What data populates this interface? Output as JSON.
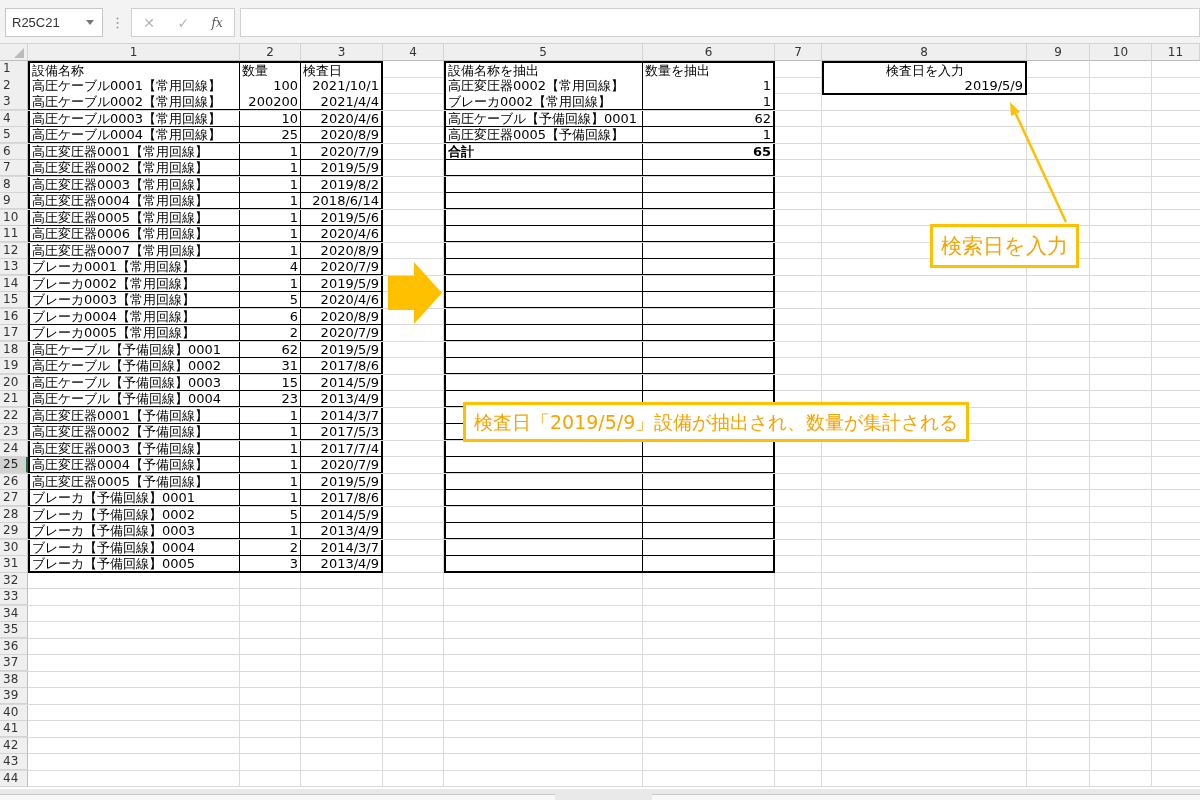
{
  "name_box": {
    "value": "R25C21"
  },
  "formula_bar": {
    "cancel": "✕",
    "enter": "✓",
    "fx": "fx"
  },
  "column_headers": [
    "1",
    "2",
    "3",
    "4",
    "5",
    "6",
    "7",
    "8",
    "9",
    "10",
    "11"
  ],
  "row_headers": [
    {
      "label": "1",
      "selected": false
    },
    {
      "label": "2",
      "selected": false
    },
    {
      "label": "3",
      "selected": false
    },
    {
      "label": "4",
      "selected": false
    },
    {
      "label": "5",
      "selected": false
    },
    {
      "label": "6",
      "selected": false
    },
    {
      "label": "7",
      "selected": false
    },
    {
      "label": "8",
      "selected": false
    },
    {
      "label": "9",
      "selected": false
    },
    {
      "label": "10",
      "selected": false
    },
    {
      "label": "11",
      "selected": false
    },
    {
      "label": "12",
      "selected": false
    },
    {
      "label": "13",
      "selected": false
    },
    {
      "label": "14",
      "selected": false
    },
    {
      "label": "15",
      "selected": false
    },
    {
      "label": "16",
      "selected": false
    },
    {
      "label": "17",
      "selected": false
    },
    {
      "label": "18",
      "selected": false
    },
    {
      "label": "19",
      "selected": false
    },
    {
      "label": "20",
      "selected": false
    },
    {
      "label": "21",
      "selected": false
    },
    {
      "label": "22",
      "selected": false
    },
    {
      "label": "23",
      "selected": false
    },
    {
      "label": "24",
      "selected": false
    },
    {
      "label": "25",
      "selected": true
    },
    {
      "label": "26",
      "selected": false
    },
    {
      "label": "27",
      "selected": false
    },
    {
      "label": "28",
      "selected": false
    },
    {
      "label": "29",
      "selected": false
    },
    {
      "label": "30",
      "selected": false
    },
    {
      "label": "31",
      "selected": false
    },
    {
      "label": "32",
      "selected": false
    },
    {
      "label": "33",
      "selected": false
    },
    {
      "label": "34",
      "selected": false
    },
    {
      "label": "35",
      "selected": false
    },
    {
      "label": "36",
      "selected": false
    },
    {
      "label": "37",
      "selected": false
    },
    {
      "label": "38",
      "selected": false
    },
    {
      "label": "39",
      "selected": false
    },
    {
      "label": "40",
      "selected": false
    },
    {
      "label": "41",
      "selected": false
    },
    {
      "label": "42",
      "selected": false
    },
    {
      "label": "43",
      "selected": false
    },
    {
      "label": "44",
      "selected": false
    }
  ],
  "equipment_table": {
    "columns": [
      "設備名称",
      "数量",
      "検査日"
    ],
    "rows": [
      [
        "高圧ケーブル0001【常用回線】",
        "100",
        "2021/10/1"
      ],
      [
        "高圧ケーブル0002【常用回線】",
        "200200",
        "2021/4/4"
      ],
      [
        "高圧ケーブル0003【常用回線】",
        "10",
        "2020/4/6"
      ],
      [
        "高圧ケーブル0004【常用回線】",
        "25",
        "2020/8/9"
      ],
      [
        "高圧変圧器0001【常用回線】",
        "1",
        "2020/7/9"
      ],
      [
        "高圧変圧器0002【常用回線】",
        "1",
        "2019/5/9"
      ],
      [
        "高圧変圧器0003【常用回線】",
        "1",
        "2019/8/2"
      ],
      [
        "高圧変圧器0004【常用回線】",
        "1",
        "2018/6/14"
      ],
      [
        "高圧変圧器0005【常用回線】",
        "1",
        "2019/5/6"
      ],
      [
        "高圧変圧器0006【常用回線】",
        "1",
        "2020/4/6"
      ],
      [
        "高圧変圧器0007【常用回線】",
        "1",
        "2020/8/9"
      ],
      [
        "ブレーカ0001【常用回線】",
        "4",
        "2020/7/9"
      ],
      [
        "ブレーカ0002【常用回線】",
        "1",
        "2019/5/9"
      ],
      [
        "ブレーカ0003【常用回線】",
        "5",
        "2020/4/6"
      ],
      [
        "ブレーカ0004【常用回線】",
        "6",
        "2020/8/9"
      ],
      [
        "ブレーカ0005【常用回線】",
        "2",
        "2020/7/9"
      ],
      [
        "高圧ケーブル【予備回線】0001",
        "62",
        "2019/5/9"
      ],
      [
        "高圧ケーブル【予備回線】0002",
        "31",
        "2017/8/6"
      ],
      [
        "高圧ケーブル【予備回線】0003",
        "15",
        "2014/5/9"
      ],
      [
        "高圧ケーブル【予備回線】0004",
        "23",
        "2013/4/9"
      ],
      [
        "高圧変圧器0001【予備回線】",
        "1",
        "2014/3/7"
      ],
      [
        "高圧変圧器0002【予備回線】",
        "1",
        "2017/5/3"
      ],
      [
        "高圧変圧器0003【予備回線】",
        "1",
        "2017/7/4"
      ],
      [
        "高圧変圧器0004【予備回線】",
        "1",
        "2020/7/9"
      ],
      [
        "高圧変圧器0005【予備回線】",
        "1",
        "2019/5/9"
      ],
      [
        "ブレーカ【予備回線】0001",
        "1",
        "2017/8/6"
      ],
      [
        "ブレーカ【予備回線】0002",
        "5",
        "2014/5/9"
      ],
      [
        "ブレーカ【予備回線】0003",
        "1",
        "2013/4/9"
      ],
      [
        "ブレーカ【予備回線】0004",
        "2",
        "2014/3/7"
      ],
      [
        "ブレーカ【予備回線】0005",
        "3",
        "2013/4/9"
      ]
    ]
  },
  "extract_table": {
    "columns": [
      "設備名称を抽出",
      "数量を抽出"
    ],
    "rows": [
      [
        "高圧変圧器0002【常用回線】",
        "1"
      ],
      [
        "ブレーカ0002【常用回線】",
        "1"
      ],
      [
        "高圧ケーブル【予備回線】0001",
        "62"
      ],
      [
        "高圧変圧器0005【予備回線】",
        "1"
      ]
    ],
    "total": {
      "label": "合計",
      "value": "65"
    }
  },
  "date_input": {
    "label": "検査日を入力",
    "value": "2019/5/9"
  },
  "callouts": [
    {
      "kind": "date",
      "text": "検索日を入力"
    },
    {
      "kind": "result",
      "text": "検査日「2019/5/9」設備が抽出され、数量が集計される"
    }
  ]
}
